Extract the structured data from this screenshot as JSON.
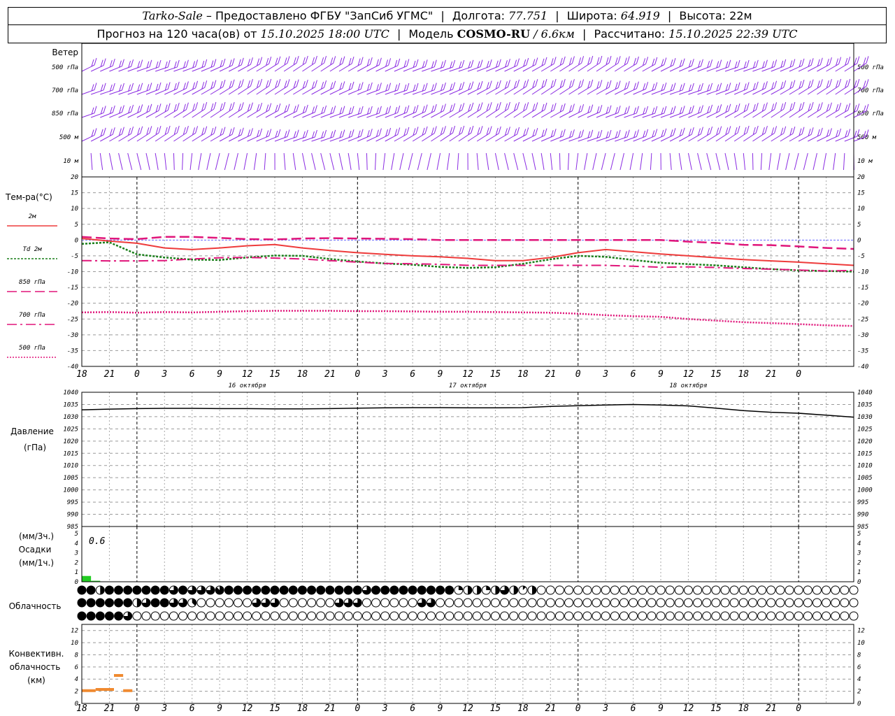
{
  "header": {
    "station": "Tarko-Sale",
    "provider": "– Предоставлено ФГБУ \"ЗапСиб УГМС\"",
    "lon_label": "Долгота:",
    "lon_value": "77.751",
    "lat_label": "Широта:",
    "lat_value": "64.919",
    "alt_label": "Высота:",
    "alt_value": "22м",
    "forecast_prefix": "Прогноз на 120 часа(ов) от",
    "forecast_start": "15.10.2025 18:00 UTC",
    "model_label": "Модель",
    "model_name": "COSMO-RU",
    "model_res": "/ 6.6км",
    "calc_label": "Рассчитано:",
    "calc_time": "15.10.2025 22:39 UTC"
  },
  "chart_data": [
    {
      "panel": "wind",
      "type": "barbs",
      "title": "Ветер",
      "levels": [
        "500 гПа",
        "700 гПа",
        "850 гПа",
        "500 м",
        "10  м"
      ],
      "color": "#8a2be2"
    },
    {
      "panel": "temperature",
      "type": "line",
      "title": "Тем-ра(°C)",
      "ylim": [
        -40,
        20
      ],
      "yticks": [
        20,
        15,
        10,
        5,
        0,
        -5,
        -10,
        -15,
        -20,
        -25,
        -30,
        -35,
        -40
      ],
      "x_hours": [
        0,
        3,
        6,
        9,
        12,
        15,
        18,
        21,
        24,
        27,
        30,
        33,
        36,
        39,
        42,
        45,
        48,
        51,
        54,
        57,
        60,
        63,
        66,
        69,
        72,
        75,
        78,
        81,
        84
      ],
      "series": [
        {
          "name": "2м",
          "color": "#ee3b3b",
          "style": "solid",
          "values": [
            0.5,
            -0.3,
            -1,
            -2.5,
            -3,
            -2.5,
            -1.8,
            -1.4,
            -2.5,
            -3.3,
            -4,
            -4.5,
            -5,
            -5.3,
            -5.8,
            -6.5,
            -6.5,
            -5.5,
            -4,
            -3,
            -3.7,
            -4.4,
            -5,
            -5.6,
            -6.2,
            -6.6,
            -7,
            -7.5,
            -8
          ]
        },
        {
          "name": "Td  2м",
          "color": "#1a7f1a",
          "style": "dotted",
          "values": [
            -1.2,
            -0.7,
            -4.5,
            -5.5,
            -6.2,
            -6.3,
            -5.5,
            -4.9,
            -5,
            -6,
            -6.8,
            -7.4,
            -7.8,
            -8.5,
            -8.8,
            -8.6,
            -7.5,
            -6.1,
            -5,
            -5.3,
            -6.3,
            -7.2,
            -7.6,
            -8,
            -8.6,
            -9.2,
            -9.6,
            -9.8,
            -10
          ]
        },
        {
          "name": "850 гПа",
          "color": "#e0157a",
          "style": "dashed",
          "values": [
            1,
            0.5,
            0.3,
            1,
            1,
            0.7,
            0.3,
            0.2,
            0.5,
            0.6,
            0.5,
            0.4,
            0.3,
            0,
            0,
            0,
            0,
            0,
            0,
            0,
            0,
            0,
            -0.5,
            -0.9,
            -1.5,
            -1.6,
            -2,
            -2.5,
            -2.8
          ]
        },
        {
          "name": "700 гПа",
          "color": "#e0157a",
          "style": "dashdot",
          "values": [
            -6.5,
            -6.6,
            -6.6,
            -6.5,
            -6,
            -5.6,
            -5.5,
            -5.7,
            -6,
            -6.5,
            -7,
            -7.4,
            -7.5,
            -7.7,
            -8,
            -8,
            -8,
            -8,
            -8,
            -8,
            -8.3,
            -8.6,
            -8.5,
            -8.7,
            -9,
            -9.2,
            -9.5,
            -9.8,
            -9.6
          ]
        },
        {
          "name": "500 гПа",
          "color": "#e0157a",
          "style": "densedot",
          "values": [
            -22.9,
            -22.8,
            -23,
            -22.8,
            -22.9,
            -22.7,
            -22.5,
            -22.4,
            -22.4,
            -22.4,
            -22.5,
            -22.5,
            -22.6,
            -22.7,
            -22.7,
            -22.8,
            -22.9,
            -23,
            -23.3,
            -23.8,
            -24.1,
            -24.3,
            -25,
            -25.5,
            -26,
            -26.3,
            -26.6,
            -27,
            -27.2
          ]
        }
      ],
      "x_hour_labels": [
        "18",
        "21",
        "0",
        "3",
        "6",
        "9",
        "12",
        "15",
        "18",
        "21",
        "0",
        "3",
        "6",
        "9",
        "12",
        "15",
        "18",
        "21",
        "0",
        "3",
        "6",
        "9",
        "12",
        "15",
        "18",
        "21",
        "0"
      ],
      "date_labels": [
        "16 октября",
        "17 октября",
        "18 октября"
      ]
    },
    {
      "panel": "pressure",
      "type": "line",
      "title": "Давление",
      "unit": "(гПа)",
      "ylim": [
        985,
        1040
      ],
      "yticks": [
        1040,
        1035,
        1030,
        1025,
        1020,
        1015,
        1010,
        1005,
        1000,
        995,
        990,
        985
      ],
      "color": "#000000",
      "x_hours": [
        0,
        3,
        6,
        9,
        12,
        15,
        18,
        21,
        24,
        27,
        30,
        33,
        36,
        39,
        42,
        45,
        48,
        51,
        54,
        57,
        60,
        63,
        66,
        69,
        72,
        75,
        78,
        81,
        84
      ],
      "values": [
        1032.8,
        1033.1,
        1033.3,
        1033.4,
        1033.4,
        1033.3,
        1033.3,
        1033.2,
        1033.2,
        1033.3,
        1033.5,
        1033.6,
        1033.7,
        1033.7,
        1033.6,
        1033.6,
        1033.7,
        1034.2,
        1034.5,
        1034.8,
        1035.0,
        1034.8,
        1034.4,
        1033.5,
        1032.5,
        1031.8,
        1031.4,
        1030.6,
        1029.8
      ]
    },
    {
      "panel": "precipitation",
      "type": "bar",
      "title": "Осадки",
      "units": [
        "(мм/3ч.)",
        "(мм/1ч.)"
      ],
      "ylim": [
        0,
        5
      ],
      "yticks": [
        5,
        4,
        3,
        2,
        1,
        0
      ],
      "total_label": "0.6",
      "color": "#22cc22",
      "bars": [
        {
          "hour": 0,
          "value": 0.6
        },
        {
          "hour": 1,
          "value": 0.1
        }
      ]
    },
    {
      "panel": "cloudiness",
      "type": "table",
      "title": "Облачность",
      "rows": [
        [
          8,
          8,
          4,
          8,
          8,
          8,
          8,
          8,
          8,
          8,
          6,
          8,
          6,
          6,
          6,
          7,
          8,
          8,
          8,
          8,
          8,
          8,
          8,
          8,
          8,
          8,
          8,
          8,
          8,
          8,
          8,
          6,
          8,
          8,
          8,
          8,
          8,
          8,
          8,
          8,
          8,
          2,
          4,
          4,
          2,
          4,
          6,
          4,
          1,
          4,
          0,
          0,
          0,
          0,
          0,
          0,
          0,
          0,
          0,
          0,
          0,
          0,
          0,
          0,
          0,
          0,
          0,
          0,
          0,
          0,
          0,
          0,
          0,
          0,
          0,
          0,
          0,
          0,
          0,
          0,
          0,
          0,
          0,
          0,
          0
        ],
        [
          8,
          8,
          8,
          8,
          8,
          8,
          4,
          6,
          8,
          8,
          6,
          6,
          3,
          0,
          0,
          0,
          0,
          0,
          0,
          6,
          6,
          6,
          0,
          0,
          0,
          0,
          0,
          0,
          6,
          6,
          6,
          0,
          0,
          0,
          0,
          0,
          0,
          6,
          6,
          0,
          0,
          0,
          0,
          0,
          0,
          0,
          0,
          0,
          0,
          0,
          0,
          0,
          0,
          0,
          0,
          0,
          0,
          0,
          0,
          0,
          0,
          0,
          0,
          0,
          0,
          0,
          0,
          0,
          0,
          0,
          0,
          0,
          0,
          0,
          0,
          0,
          0,
          0,
          0,
          0,
          0,
          0,
          0,
          0,
          0
        ],
        [
          8,
          8,
          8,
          8,
          8,
          6,
          0,
          0,
          0,
          0,
          0,
          0,
          0,
          0,
          0,
          0,
          0,
          0,
          0,
          0,
          0,
          0,
          0,
          0,
          0,
          0,
          0,
          0,
          0,
          0,
          0,
          0,
          0,
          0,
          0,
          0,
          0,
          0,
          0,
          0,
          0,
          0,
          0,
          0,
          0,
          0,
          0,
          0,
          0,
          0,
          0,
          0,
          0,
          0,
          0,
          0,
          0,
          0,
          0,
          0,
          0,
          0,
          0,
          0,
          0,
          0,
          0,
          0,
          0,
          0,
          0,
          0,
          0,
          0,
          0,
          0,
          0,
          0,
          0,
          0,
          0,
          0,
          0,
          0,
          0
        ]
      ]
    },
    {
      "panel": "convective",
      "type": "bar",
      "title": "Конвективн.",
      "title2": "облачность",
      "unit": "(км)",
      "ylim": [
        0,
        13
      ],
      "yticks": [
        12,
        10,
        8,
        6,
        4,
        2,
        0
      ],
      "color": "#f08a30",
      "segments": [
        {
          "h_from": 0,
          "h_to": 1.5,
          "height": 2.1
        },
        {
          "h_from": 1.5,
          "h_to": 3.5,
          "height": 2.3
        },
        {
          "h_from": 3.5,
          "h_to": 4.5,
          "height": 4.6
        },
        {
          "h_from": 4.5,
          "h_to": 5.5,
          "height": 2.1
        }
      ]
    }
  ]
}
